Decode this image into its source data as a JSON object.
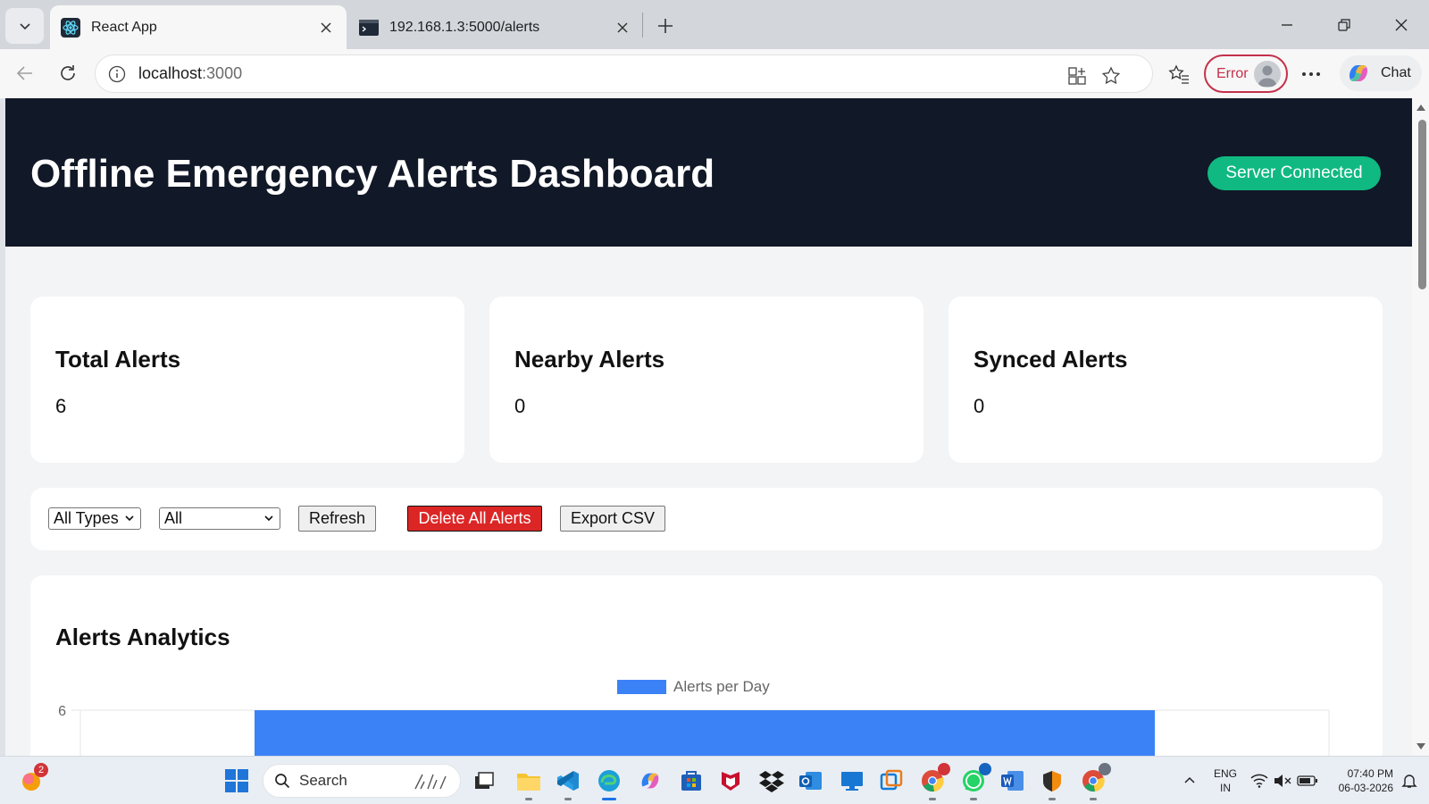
{
  "browser": {
    "tabs": [
      {
        "title": "React App",
        "active": true,
        "icon": "react-icon"
      },
      {
        "title": "192.168.1.3:5000/alerts",
        "active": false,
        "icon": "terminal-icon"
      }
    ],
    "address": {
      "host": "localhost",
      "port": ":3000"
    },
    "profile_status": "Error",
    "chat_label": "Chat"
  },
  "app": {
    "title": "Offline Emergency Alerts Dashboard",
    "status": "Server Connected",
    "colors": {
      "header_bg": "#111827",
      "status": "#10b981",
      "danger": "#dc2626",
      "bar": "#3b82f6"
    }
  },
  "stats": [
    {
      "label": "Total Alerts",
      "value": "6"
    },
    {
      "label": "Nearby Alerts",
      "value": "0"
    },
    {
      "label": "Synced Alerts",
      "value": "0"
    }
  ],
  "controls": {
    "type_filter": "All Types",
    "status_filter": "All",
    "refresh": "Refresh",
    "delete_all": "Delete All Alerts",
    "export": "Export CSV"
  },
  "analytics": {
    "title": "Alerts Analytics"
  },
  "chart_data": {
    "type": "bar",
    "legend": [
      "Alerts per Day"
    ],
    "legend_position": "top-center",
    "series": [
      {
        "name": "Alerts per Day",
        "values": [
          6
        ],
        "color": "#3b82f6"
      }
    ],
    "yticks_visible": [
      6
    ],
    "grid": true
  },
  "taskbar": {
    "search_placeholder": "Search",
    "notification_badge": "2",
    "lang_line1": "ENG",
    "lang_line2": "IN",
    "time": "07:40 PM",
    "date": "06-03-2026"
  }
}
